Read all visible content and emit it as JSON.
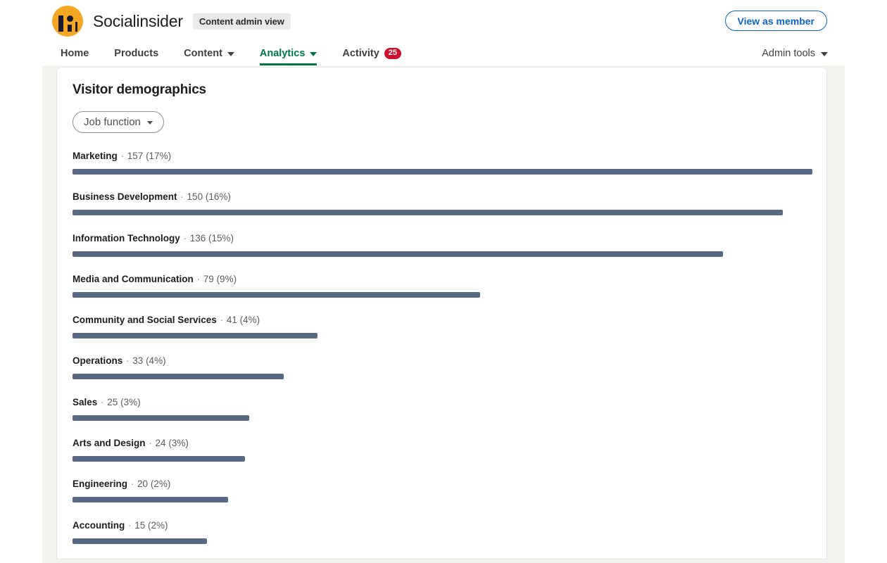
{
  "header": {
    "brand_name": "Socialinsider",
    "admin_view_label": "Content admin view",
    "view_as_member_label": "View as member",
    "logo_icon": "socialinsider-logo-icon"
  },
  "nav": {
    "items": [
      {
        "label": "Home",
        "active": false,
        "has_chevron": false,
        "badge": ""
      },
      {
        "label": "Products",
        "active": false,
        "has_chevron": false,
        "badge": ""
      },
      {
        "label": "Content",
        "active": false,
        "has_chevron": true,
        "badge": ""
      },
      {
        "label": "Analytics",
        "active": true,
        "has_chevron": true,
        "badge": ""
      },
      {
        "label": "Activity",
        "active": false,
        "has_chevron": false,
        "badge": "25"
      }
    ],
    "admin_tools_label": "Admin tools"
  },
  "main": {
    "title": "Visitor demographics",
    "filter_label": "Job function"
  },
  "chart_data": {
    "type": "bar",
    "title": "Visitor demographics",
    "subtitle": "Job function",
    "orientation": "horizontal",
    "xlabel": "",
    "ylabel": "",
    "grid": false,
    "legend": false,
    "bar_color": "#566a85",
    "max_value": 157,
    "categories": [
      "Marketing",
      "Business Development",
      "Information Technology",
      "Media and Communication",
      "Community and Social Services",
      "Operations",
      "Sales",
      "Arts and Design",
      "Engineering",
      "Accounting"
    ],
    "values": [
      157,
      150,
      136,
      79,
      41,
      33,
      25,
      24,
      20,
      15
    ],
    "percents": [
      "17%",
      "16%",
      "15%",
      "9%",
      "4%",
      "4%",
      "3%",
      "3%",
      "2%",
      "2%"
    ],
    "rows": [
      {
        "name": "Marketing",
        "count": "157",
        "percent": "(17%)",
        "value": 157
      },
      {
        "name": "Business Development",
        "count": "150",
        "percent": "(16%)",
        "value": 150
      },
      {
        "name": "Information Technology",
        "count": "136",
        "percent": "(15%)",
        "value": 136
      },
      {
        "name": "Media and Communication",
        "count": "79",
        "percent": "(9%)",
        "value": 79
      },
      {
        "name": "Community and Social Services",
        "count": "41",
        "percent": "(4%)",
        "value": 41
      },
      {
        "name": "Operations",
        "count": "33",
        "percent": "(4%)",
        "value": 33
      },
      {
        "name": "Sales",
        "count": "25",
        "percent": "(3%)",
        "value": 25
      },
      {
        "name": "Arts and Design",
        "count": "24",
        "percent": "(3%)",
        "value": 24
      },
      {
        "name": "Engineering",
        "count": "20",
        "percent": "(2%)",
        "value": 20
      },
      {
        "name": "Accounting",
        "count": "15",
        "percent": "(2%)",
        "value": 15
      }
    ]
  },
  "colors": {
    "accent_green": "#057642",
    "link_blue": "#0a66c2",
    "badge_red": "#cb112d",
    "bar_slate": "#566a85",
    "logo_amber": "#f5a623",
    "page_bg": "#f3f2ef"
  }
}
